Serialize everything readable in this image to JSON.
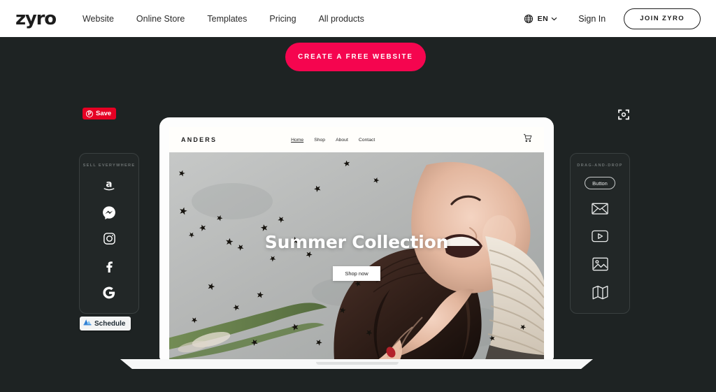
{
  "topnav": {
    "logo": "zyro",
    "links": [
      {
        "label": "Website"
      },
      {
        "label": "Online Store"
      },
      {
        "label": "Templates"
      },
      {
        "label": "Pricing"
      },
      {
        "label": "All products"
      }
    ],
    "language": "EN",
    "signin": "Sign In",
    "join": "JOIN ZYRO",
    "icons": {
      "globe": "globe-icon",
      "chevron": "chevron-down-icon"
    }
  },
  "cta": {
    "label": "CREATE A FREE WEBSITE",
    "color": "#f5054f"
  },
  "overlays": {
    "pinterest_save": {
      "label": "Save",
      "glyph": "P",
      "color": "#e60023"
    },
    "schedule": {
      "label": "Schedule"
    },
    "fullscreen_icon": "fullscreen-expand-icon"
  },
  "left_panel": {
    "title": "SELL EVERYWHERE",
    "items": [
      {
        "name": "amazon-icon",
        "label": "Amazon"
      },
      {
        "name": "messenger-icon",
        "label": "Facebook Messenger"
      },
      {
        "name": "instagram-icon",
        "label": "Instagram"
      },
      {
        "name": "facebook-icon",
        "label": "Facebook"
      },
      {
        "name": "google-icon",
        "label": "Google"
      }
    ]
  },
  "right_panel": {
    "title": "DRAG-AND-DROP",
    "button_label": "Button",
    "items": [
      {
        "name": "button-element",
        "label": "Button"
      },
      {
        "name": "email-icon",
        "label": "Email"
      },
      {
        "name": "video-icon",
        "label": "Video"
      },
      {
        "name": "image-icon",
        "label": "Image"
      },
      {
        "name": "map-icon",
        "label": "Map"
      }
    ]
  },
  "preview_site": {
    "brand": "ANDERS",
    "nav": [
      {
        "label": "Home",
        "active": true
      },
      {
        "label": "Shop",
        "active": false
      },
      {
        "label": "About",
        "active": false
      },
      {
        "label": "Contact",
        "active": false
      }
    ],
    "cart_icon": "shopping-cart-icon",
    "hero": {
      "title": "Summer Collection",
      "button": "Shop now"
    }
  },
  "colors": {
    "background": "#1e2323",
    "accent": "#f5054f",
    "nav_bg": "#ffffff",
    "panel_bg": "#222727",
    "panel_border": "#3a4040"
  }
}
